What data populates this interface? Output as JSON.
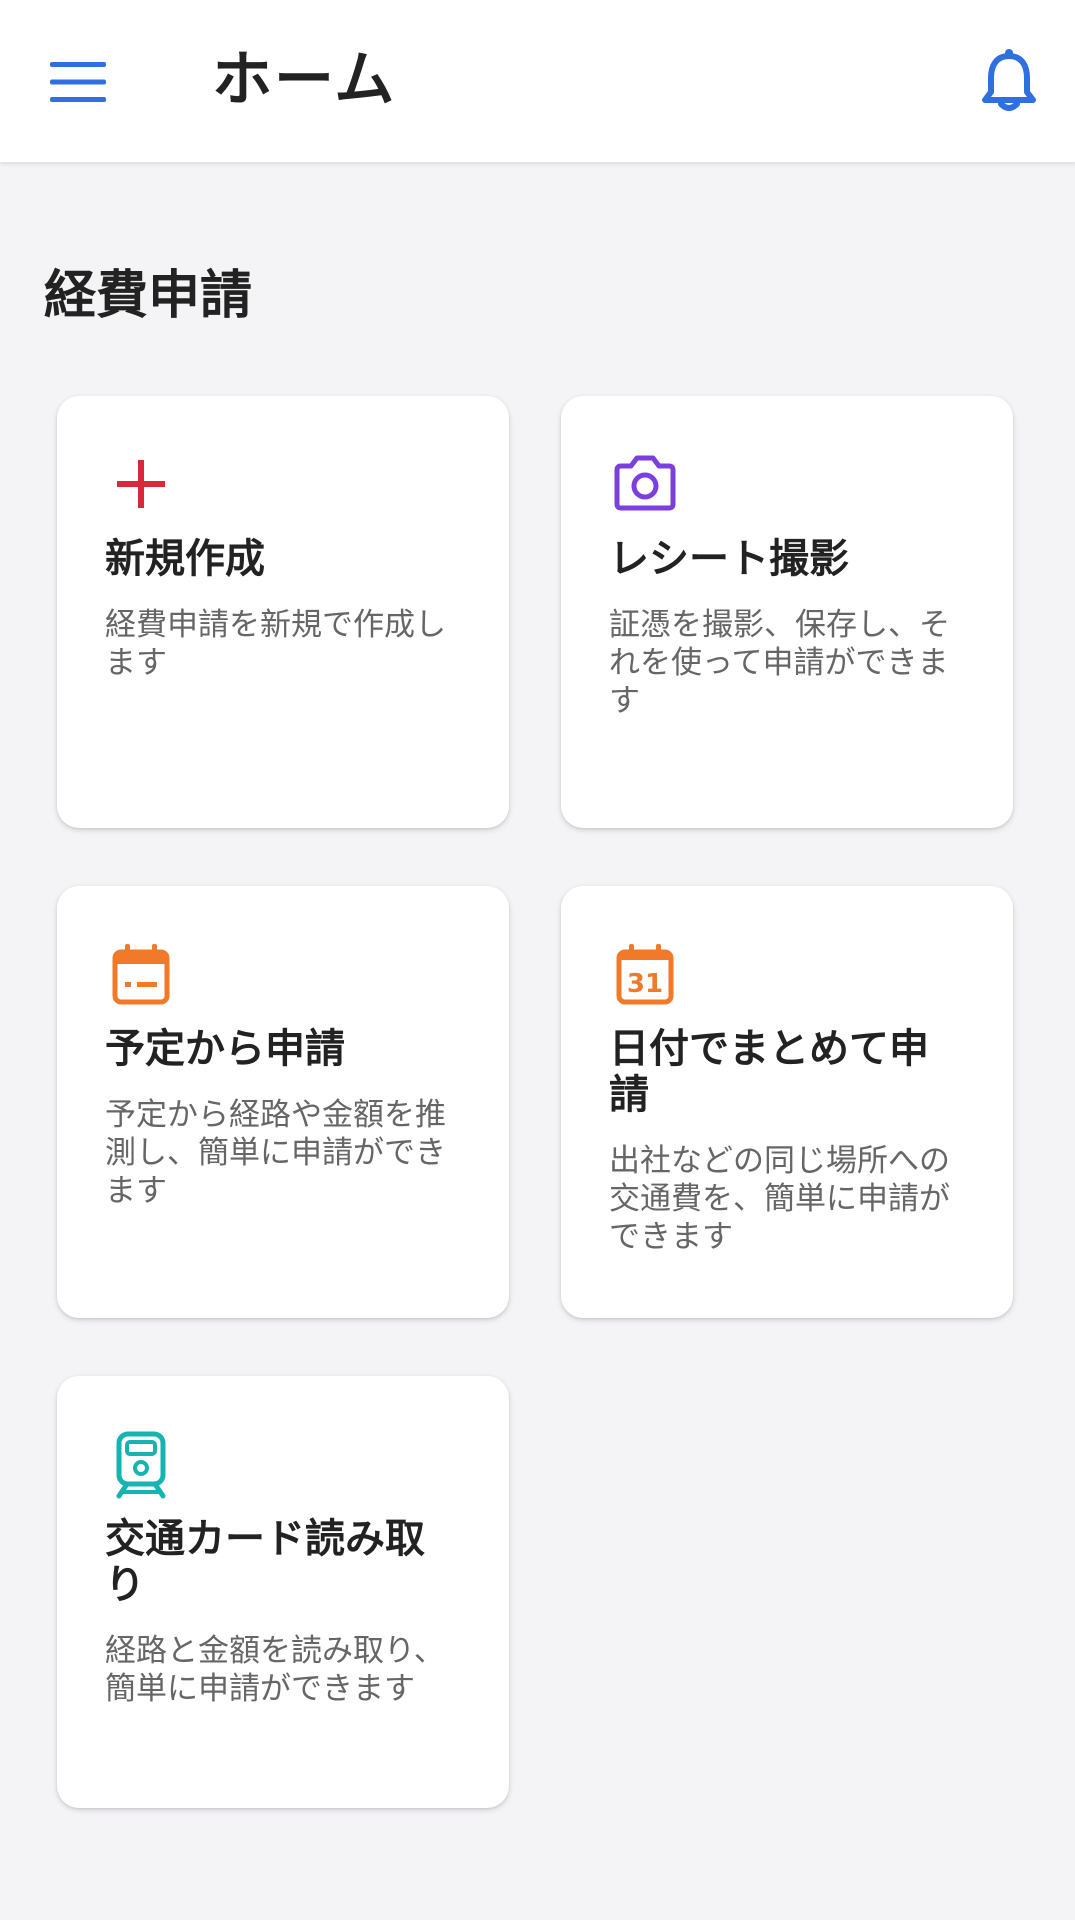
{
  "app_bar": {
    "title": "ホーム",
    "menu_icon": "hamburger-menu-icon",
    "notification_icon": "bell-icon",
    "accent_color": "#2f6fe0"
  },
  "section": {
    "title": "経費申請"
  },
  "cards": [
    {
      "icon": "plus-icon",
      "icon_color": "#d8283a",
      "title": "新規作成",
      "description": "経費申請を新規で作成します"
    },
    {
      "icon": "camera-icon",
      "icon_color": "#7b3fe0",
      "title": "レシート撮影",
      "description": "証憑を撮影、保存し、それを使って申請ができます"
    },
    {
      "icon": "calendar-icon",
      "icon_color": "#f07a2a",
      "title": "予定から申請",
      "description": "予定から経路や金額を推測し、簡単に申請ができます"
    },
    {
      "icon": "calendar-31-icon",
      "icon_color": "#f07a2a",
      "icon_text": "31",
      "title": "日付でまとめて申請",
      "description": "出社などの同じ場所への交通費を、簡単に申請ができます"
    },
    {
      "icon": "train-icon",
      "icon_color": "#16b3b0",
      "title": "交通カード読み取り",
      "description": "経路と金額を読み取り、簡単に申請ができます"
    }
  ]
}
